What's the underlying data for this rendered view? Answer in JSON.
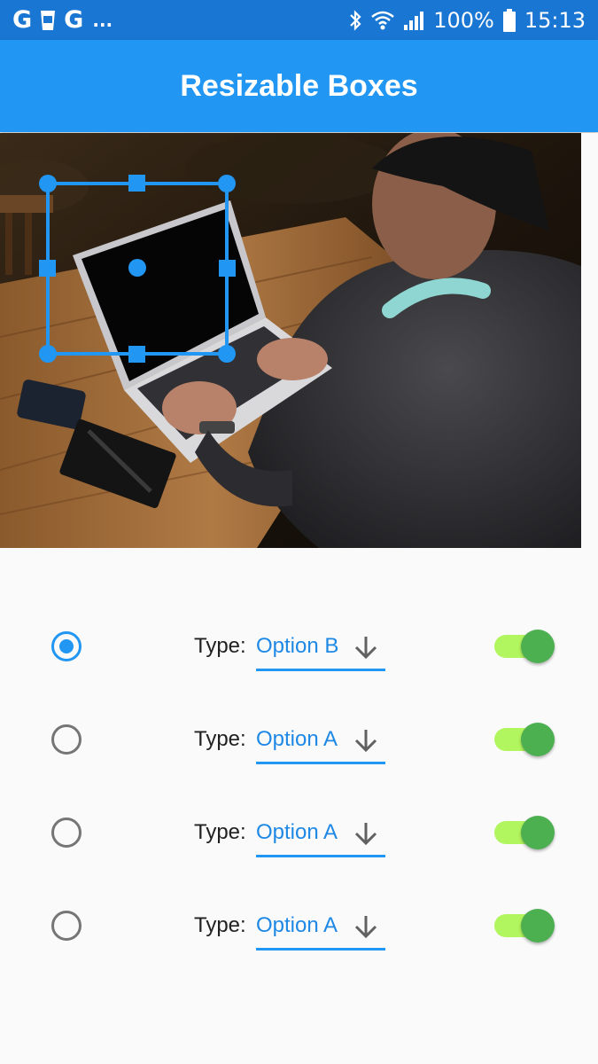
{
  "status_bar": {
    "left_icons": [
      "G",
      "G"
    ],
    "overflow": "...",
    "battery": "100%",
    "time": "15:13",
    "icons": [
      "google-icon",
      "coffee-cup-icon",
      "google-icon",
      "bluetooth-icon",
      "wifi-icon",
      "cell-signal-icon",
      "battery-icon"
    ]
  },
  "app_bar": {
    "title": "Resizable Boxes",
    "color": "#2196f3"
  },
  "photo": {
    "description_icon": "laptop-photo"
  },
  "options": {
    "label": "Type:",
    "rows": [
      {
        "selected": true,
        "value": "Option B",
        "toggle_on": true
      },
      {
        "selected": false,
        "value": "Option A",
        "toggle_on": true
      },
      {
        "selected": false,
        "value": "Option A",
        "toggle_on": true
      },
      {
        "selected": false,
        "value": "Option A",
        "toggle_on": true
      }
    ]
  },
  "colors": {
    "accent": "#2196f3",
    "status_bar": "#1976d2",
    "toggle_thumb": "#4caf50",
    "toggle_track": "#b2f65f",
    "background": "#fafafa"
  }
}
